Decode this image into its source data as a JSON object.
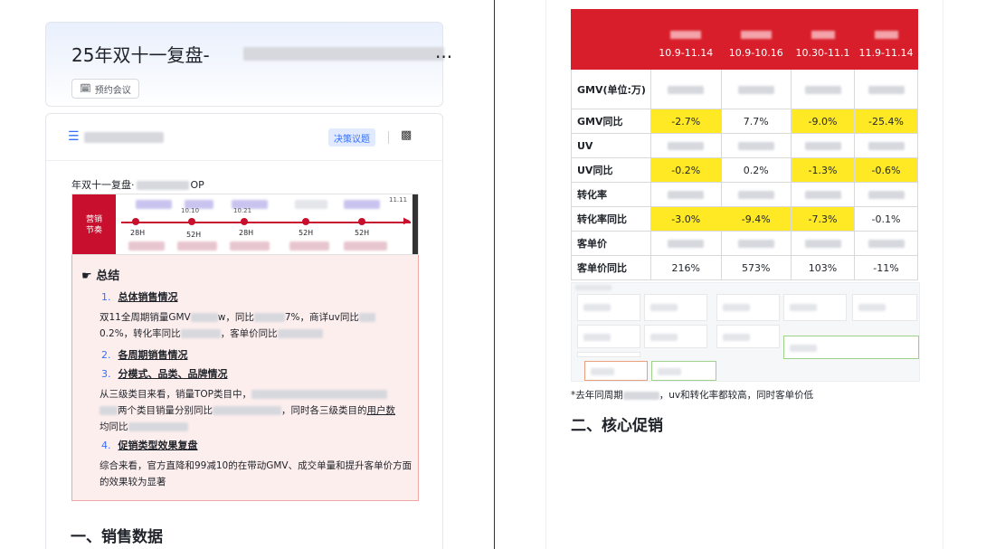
{
  "left": {
    "title_prefix": "25年双十一复盘-",
    "title_suffix": "...",
    "meeting_label": "预约会议",
    "decision_label": "决策议题",
    "doc_subtitle_prefix": "年双十一复盘·",
    "doc_subtitle_suffix": "OP",
    "timeline": {
      "label_line1": "营销",
      "label_line2": "节奏",
      "hours": [
        "28H",
        "52H",
        "28H",
        "52H",
        "52H"
      ],
      "top_texts": [
        "10.10",
        "10.21",
        "11.11"
      ]
    },
    "summary": {
      "title": "总结",
      "items": [
        {
          "num": "1.",
          "label": "总体销售情况"
        },
        {
          "num": "2.",
          "label": "各周期销售情况"
        },
        {
          "num": "3.",
          "label": "分模式、品类、品牌情况"
        },
        {
          "num": "4.",
          "label": "促销类型效果复盘"
        }
      ],
      "para1": {
        "t1": "双11全周期销量GMV",
        "t2": "w，同比",
        "t3": "7%，商详uv同比",
        "t4": "0.2%，转化率同比",
        "t5": "，客单价同比"
      },
      "para3": {
        "t1": "从三级类目来看，销量TOP类目中，",
        "t2": "两个类目销量分别同比",
        "t3": "，同时各三级类目的",
        "t4": "用户数",
        "t5": "均同比"
      },
      "para4": "综合来看，官方直降和99减10的在带动GMV、成交单量和提升客单价方面的效果较为显著"
    },
    "section_title": "一、销售数据"
  },
  "right": {
    "columns": [
      "10.9-11.14",
      "10.9-10.16",
      "10.30-11.1",
      "11.9-11.14"
    ],
    "rows": [
      {
        "label": "GMV(单位:万)",
        "cells": [
          "",
          "",
          "",
          ""
        ],
        "highlight": [
          false,
          false,
          false,
          false
        ]
      },
      {
        "label": "GMV同比",
        "cells": [
          "-2.7%",
          "7.7%",
          "-9.0%",
          "-25.4%"
        ],
        "highlight": [
          true,
          false,
          true,
          true
        ]
      },
      {
        "label": "UV",
        "cells": [
          "",
          "",
          "",
          ""
        ],
        "highlight": [
          false,
          false,
          false,
          false
        ]
      },
      {
        "label": "UV同比",
        "cells": [
          "-0.2%",
          "0.2%",
          "-1.3%",
          "-0.6%"
        ],
        "highlight": [
          true,
          false,
          true,
          true
        ]
      },
      {
        "label": "转化率",
        "cells": [
          "",
          "",
          "",
          ""
        ],
        "highlight": [
          false,
          false,
          false,
          false
        ]
      },
      {
        "label": "转化率同比",
        "cells": [
          "-3.0%",
          "-9.4%",
          "-7.3%",
          "-0.1%"
        ],
        "highlight": [
          true,
          true,
          true,
          false
        ]
      },
      {
        "label": "客单价",
        "cells": [
          "",
          "",
          "",
          ""
        ],
        "highlight": [
          false,
          false,
          false,
          false
        ]
      },
      {
        "label": "客单价同比",
        "cells": [
          "216%",
          "573%",
          "103%",
          "-11%"
        ],
        "highlight": [
          false,
          false,
          false,
          false
        ]
      }
    ],
    "note_prefix": "*去年同周期",
    "note_suffix": "，uv和转化率都较高，同时客单价低",
    "section_title": "二、核心促销"
  },
  "colors": {
    "header_red": "#d81e2a",
    "highlight_yellow": "#ffe925",
    "accent_blue": "#3370ff",
    "summary_bg": "#fdeeee"
  }
}
